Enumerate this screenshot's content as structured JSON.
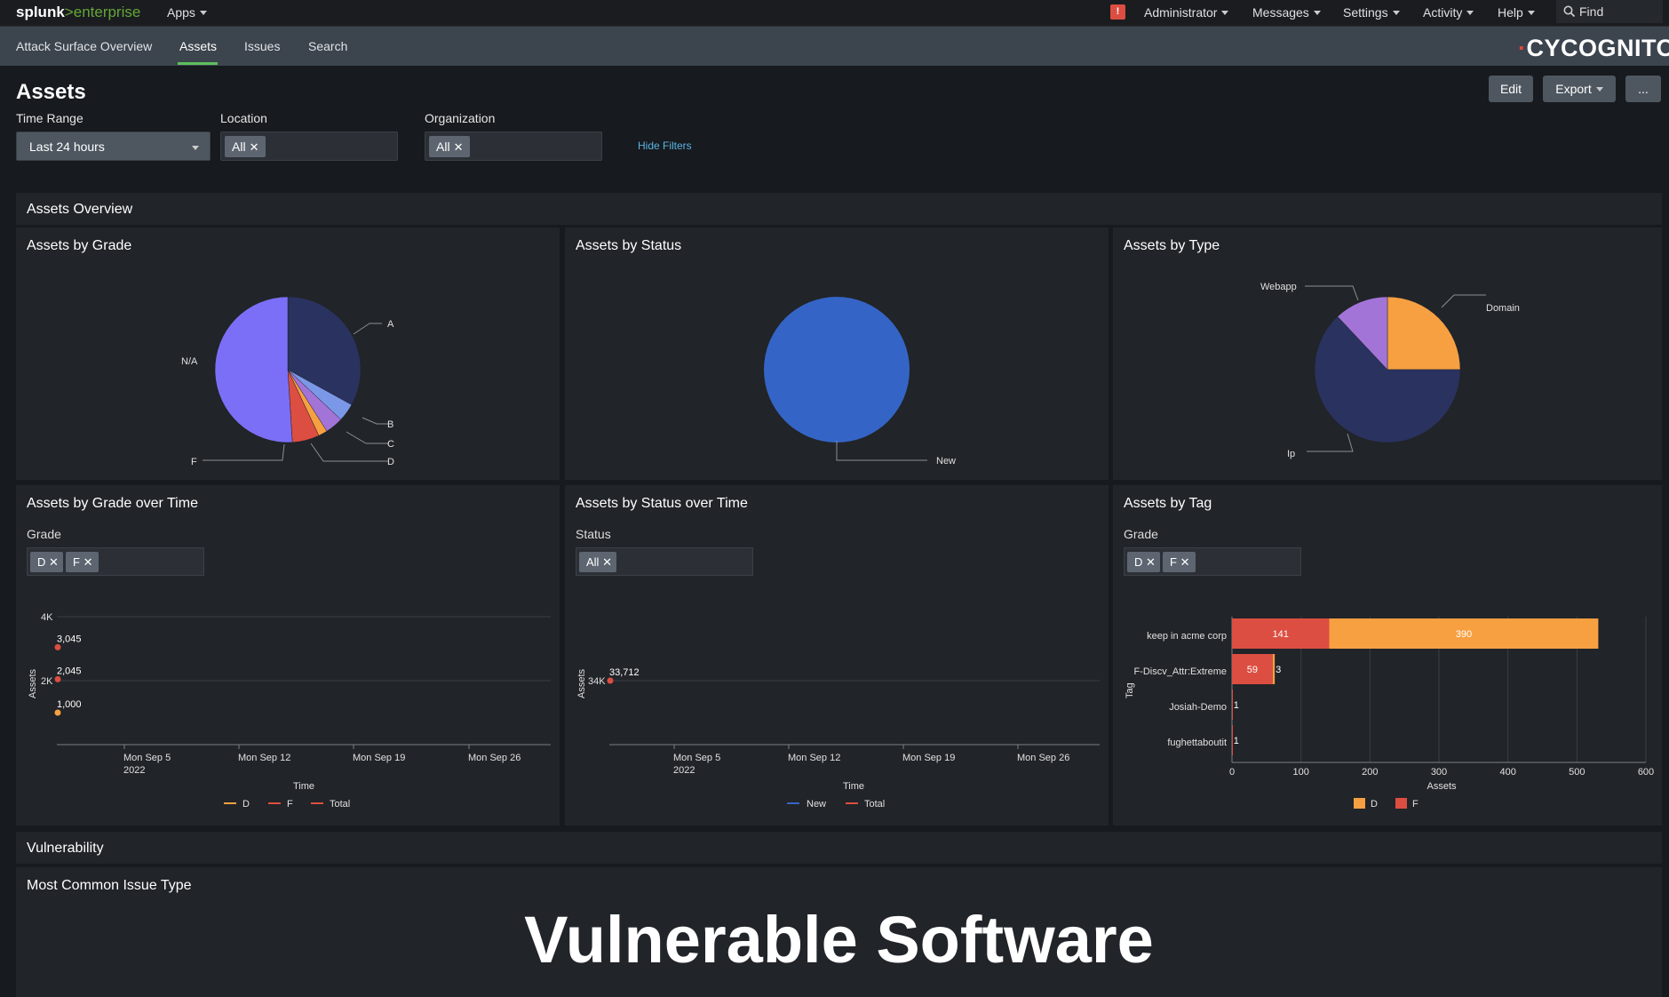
{
  "topbar": {
    "logo_main": "splunk",
    "logo_sep": ">",
    "logo_product": "enterprise",
    "apps": "Apps",
    "alert": "!",
    "administrator": "Administrator",
    "messages": "Messages",
    "settings": "Settings",
    "activity": "Activity",
    "help": "Help",
    "find": "Find"
  },
  "appbar": {
    "tabs": [
      {
        "label": "Attack Surface Overview"
      },
      {
        "label": "Assets"
      },
      {
        "label": "Issues"
      },
      {
        "label": "Search"
      }
    ],
    "active_tab": "Assets",
    "brand": "CYCOGNITO",
    "brand_accent_color": "#e0453a"
  },
  "page": {
    "title": "Assets",
    "edit": "Edit",
    "export": "Export",
    "more": "..."
  },
  "filters": {
    "time_range_label": "Time Range",
    "time_range_value": "Last 24 hours",
    "location_label": "Location",
    "location_chip": "All",
    "organization_label": "Organization",
    "organization_chip": "All",
    "hide_filters": "Hide Filters"
  },
  "sections": {
    "overview": "Assets Overview",
    "vulnerability": "Vulnerability"
  },
  "panels": {
    "grade": {
      "title": "Assets by Grade",
      "chart_data": {
        "type": "pie",
        "labels": [
          "A",
          "B",
          "C",
          "D",
          "F",
          "N/A"
        ],
        "values": [
          33,
          4,
          4,
          2,
          6,
          51
        ],
        "colors": [
          "#2a3260",
          "#7b98e8",
          "#a374d8",
          "#f7a042",
          "#dc4e41",
          "#7c6ff7"
        ]
      }
    },
    "status": {
      "title": "Assets by Status",
      "chart_data": {
        "type": "pie",
        "labels": [
          "New"
        ],
        "values": [
          100
        ],
        "colors": [
          "#3465c6"
        ]
      }
    },
    "type": {
      "title": "Assets by Type",
      "chart_data": {
        "type": "pie",
        "labels": [
          "Domain",
          "Ip",
          "Webapp"
        ],
        "values": [
          25,
          63,
          12
        ],
        "colors": [
          "#f7a042",
          "#2a3260",
          "#a374d8"
        ]
      }
    },
    "grade_time": {
      "title": "Assets by Grade over Time",
      "filter_label": "Grade",
      "chips": [
        "D",
        "F"
      ],
      "chart_data": {
        "type": "line",
        "x_ticks": [
          "Mon Sep 5\n2022",
          "Mon Sep 12",
          "Mon Sep 19",
          "Mon Sep 26"
        ],
        "y_ticks": [
          "2K",
          "4K"
        ],
        "ylim": [
          0,
          4000
        ],
        "xlabel": "Time",
        "ylabel": "Assets",
        "series": [
          {
            "name": "D",
            "color": "#f7a042",
            "values": [
              1000
            ],
            "label": "1,000"
          },
          {
            "name": "F",
            "color": "#dc4e41",
            "values": [
              2045
            ],
            "label": "2,045"
          },
          {
            "name": "Total",
            "color": "#dc4e41",
            "values": [
              3045
            ],
            "label": "3,045"
          }
        ]
      }
    },
    "status_time": {
      "title": "Assets by Status over Time",
      "filter_label": "Status",
      "chips": [
        "All"
      ],
      "chart_data": {
        "type": "line",
        "x_ticks": [
          "Mon Sep 5\n2022",
          "Mon Sep 12",
          "Mon Sep 19",
          "Mon Sep 26"
        ],
        "y_ticks": [
          "34K"
        ],
        "xlabel": "Time",
        "ylabel": "Assets",
        "series": [
          {
            "name": "New",
            "color": "#3465c6",
            "values": [
              33712
            ]
          },
          {
            "name": "Total",
            "color": "#dc4e41",
            "values": [
              33712
            ],
            "label": "33,712"
          }
        ]
      }
    },
    "tag": {
      "title": "Assets by Tag",
      "filter_label": "Grade",
      "chips": [
        "D",
        "F"
      ],
      "chart_data": {
        "type": "bar",
        "orientation": "horizontal",
        "stacked": true,
        "categories": [
          "keep in acme corp",
          "F-Discv_Attr:Extreme",
          "Josiah-Demo",
          "fughettaboutit"
        ],
        "series": [
          {
            "name": "F",
            "color": "#dc4e41",
            "values": [
              141,
              59,
              1,
              1
            ],
            "labels": [
              "141",
              "59",
              "1",
              "1"
            ]
          },
          {
            "name": "D",
            "color": "#f7a042",
            "values": [
              390,
              3,
              0,
              0
            ],
            "labels": [
              "390",
              "3",
              "",
              ""
            ]
          }
        ],
        "legend": [
          "D",
          "F"
        ],
        "xlim": [
          0,
          600
        ],
        "x_ticks": [
          "0",
          "100",
          "200",
          "300",
          "400",
          "500",
          "600"
        ],
        "xlabel": "Assets",
        "ylabel": "Tag"
      }
    },
    "issue": {
      "title": "Most Common Issue Type",
      "value": "Vulnerable Software"
    }
  }
}
